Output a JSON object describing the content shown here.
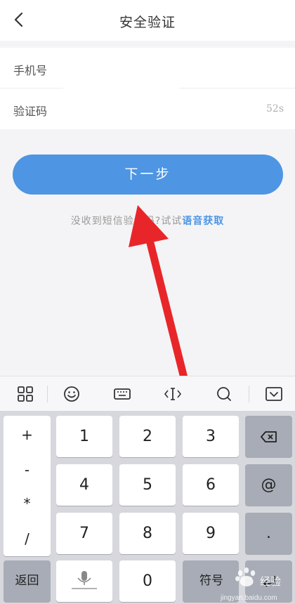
{
  "header": {
    "title": "安全验证",
    "back_icon": "chevron-left-icon"
  },
  "form": {
    "phone_label": "手机号",
    "phone_value": "",
    "code_label": "验证码",
    "code_value": "",
    "countdown": "52s"
  },
  "actions": {
    "next_label": "下一步"
  },
  "hint": {
    "prefix": "没收到短信验证码?试试",
    "link": "语音获取"
  },
  "colors": {
    "accent": "#4e95e3",
    "arrow": "#e8262a"
  },
  "keyboard": {
    "toolbar_icons": [
      "grid-icon",
      "emoji-icon",
      "keyboard-icon",
      "cursor-icon",
      "search-icon",
      "collapse-keyboard-icon"
    ],
    "symbols": [
      "+",
      "-",
      "*",
      "/"
    ],
    "digits": [
      "1",
      "2",
      "3",
      "4",
      "5",
      "6",
      "7",
      "8",
      "9"
    ],
    "zero": "0",
    "at": "@",
    "dot": ".",
    "back_label": "返回",
    "symbol_label": "符号",
    "backspace_icon": "backspace-icon",
    "enter_icon": "enter-icon",
    "mic_icon": "microphone-icon"
  },
  "watermark": {
    "text": "经验",
    "site": "jingyan.baidu.com"
  }
}
